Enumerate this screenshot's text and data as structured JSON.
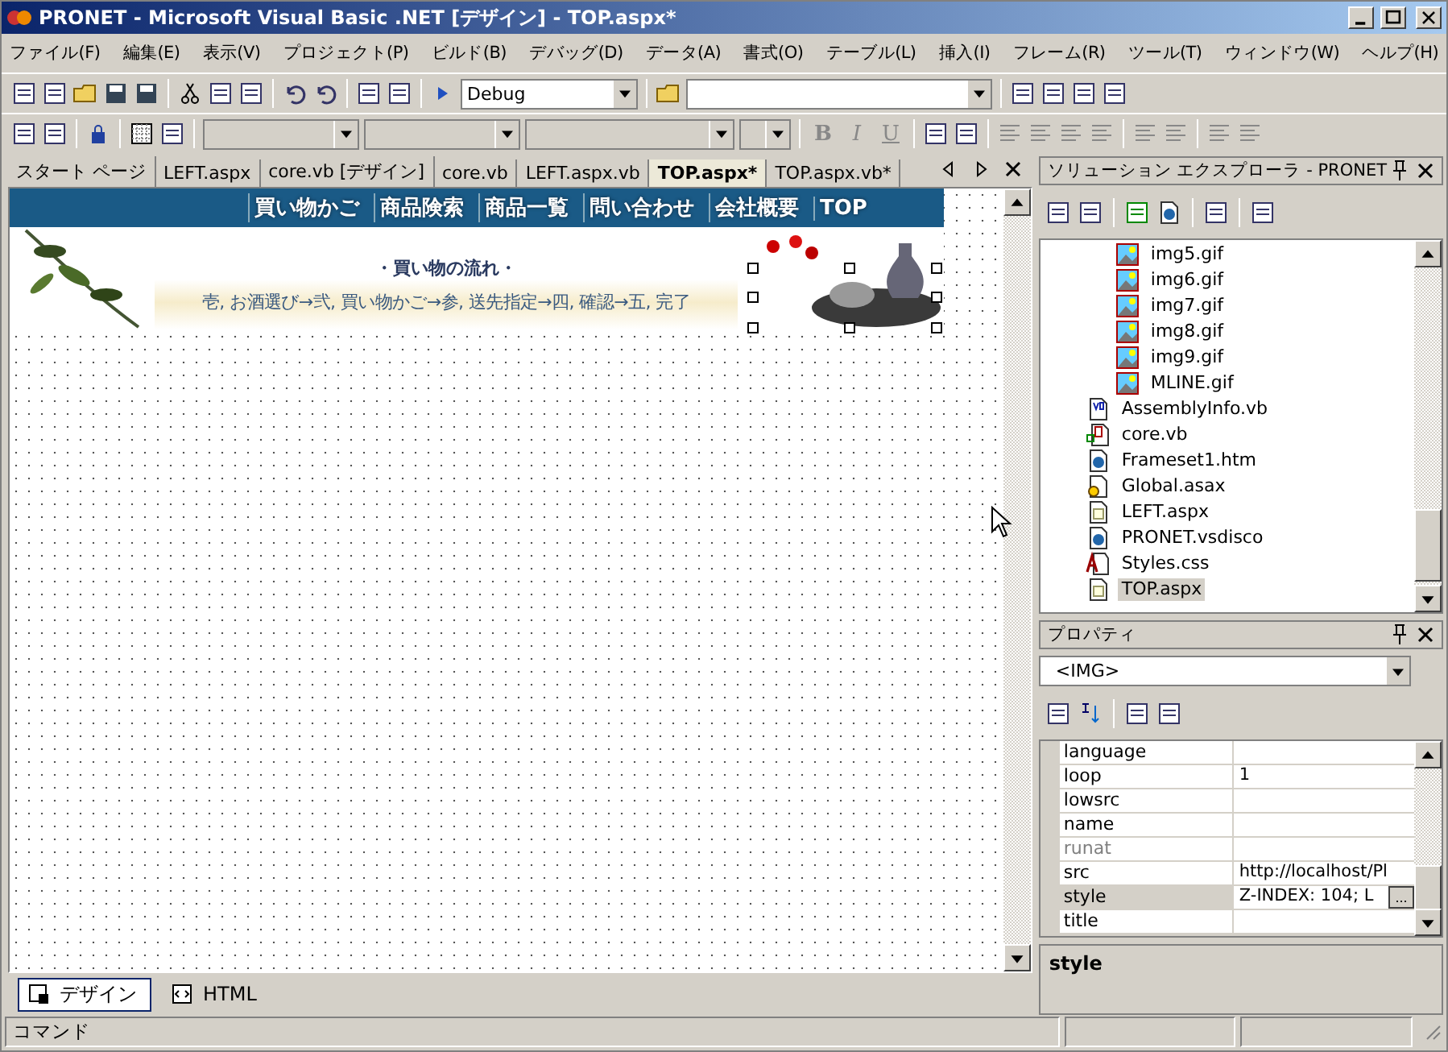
{
  "window": {
    "title": "PRONET - Microsoft Visual Basic .NET [デザイン] - TOP.aspx*"
  },
  "menu": [
    "ファイル(F)",
    "編集(E)",
    "表示(V)",
    "プロジェクト(P)",
    "ビルド(B)",
    "デバッグ(D)",
    "データ(A)",
    "書式(O)",
    "テーブル(L)",
    "挿入(I)",
    "フレーム(R)",
    "ツール(T)",
    "ウィンドウ(W)",
    "ヘルプ(H)"
  ],
  "toolbar": {
    "configuration": "Debug",
    "format_buttons": [
      "B",
      "I",
      "U"
    ]
  },
  "tabs": [
    {
      "label": "スタート ページ",
      "selected": false
    },
    {
      "label": "LEFT.aspx",
      "selected": false
    },
    {
      "label": "core.vb [デザイン]",
      "selected": false
    },
    {
      "label": "core.vb",
      "selected": false
    },
    {
      "label": "LEFT.aspx.vb",
      "selected": false
    },
    {
      "label": "TOP.aspx*",
      "selected": true
    },
    {
      "label": "TOP.aspx.vb*",
      "selected": false
    }
  ],
  "page": {
    "nav": [
      "買い物かご",
      "商品険索",
      "商品一覧",
      "問い合わせ",
      "会社概要",
      "TOP"
    ],
    "flow_title": "・買い物の流れ・",
    "flow": "壱, お酒選び→弐, 買い物かご→参, 送先指定→四, 確認→五, 完了"
  },
  "views": [
    {
      "label": "デザイン",
      "selected": true
    },
    {
      "label": "HTML",
      "selected": false
    }
  ],
  "status": "コマンド",
  "solution": {
    "title": "ソリューション エクスプローラ - PRONET",
    "items": [
      {
        "kind": "group",
        "children": [
          {
            "label": "img5.gif",
            "kind": "image",
            "selected": false
          },
          {
            "label": "img6.gif",
            "kind": "image",
            "selected": false
          },
          {
            "label": "img7.gif",
            "kind": "image",
            "selected": false
          },
          {
            "label": "img8.gif",
            "kind": "image",
            "selected": false
          },
          {
            "label": "img9.gif",
            "kind": "image",
            "selected": false
          },
          {
            "label": "MLINE.gif",
            "kind": "image",
            "selected": false
          }
        ]
      },
      {
        "label": "AssemblyInfo.vb",
        "kind": "vb",
        "selected": false
      },
      {
        "label": "core.vb",
        "kind": "class",
        "selected": false
      },
      {
        "label": "Frameset1.htm",
        "kind": "web",
        "selected": false
      },
      {
        "label": "Global.asax",
        "kind": "global",
        "selected": false
      },
      {
        "label": "LEFT.aspx",
        "kind": "form",
        "selected": false
      },
      {
        "label": "PRONET.vsdisco",
        "kind": "disco",
        "selected": false
      },
      {
        "label": "Styles.css",
        "kind": "css",
        "selected": false
      },
      {
        "label": "TOP.aspx",
        "kind": "form",
        "selected": true
      }
    ]
  },
  "properties": {
    "title": "プロパティ",
    "object": "<IMG>",
    "rows": [
      {
        "name": "language",
        "value": "",
        "disabled": false,
        "selected": false
      },
      {
        "name": "loop",
        "value": "1",
        "disabled": false,
        "selected": false
      },
      {
        "name": "lowsrc",
        "value": "",
        "disabled": false,
        "selected": false
      },
      {
        "name": "name",
        "value": "",
        "disabled": false,
        "selected": false
      },
      {
        "name": "runat",
        "value": "",
        "disabled": true,
        "selected": false
      },
      {
        "name": "src",
        "value": "http://localhost/Pl",
        "disabled": false,
        "selected": false
      },
      {
        "name": "style",
        "value": "Z-INDEX: 104; L",
        "disabled": false,
        "selected": true,
        "button": "..."
      },
      {
        "name": "title",
        "value": "",
        "disabled": false,
        "selected": false
      }
    ],
    "description": "style"
  }
}
